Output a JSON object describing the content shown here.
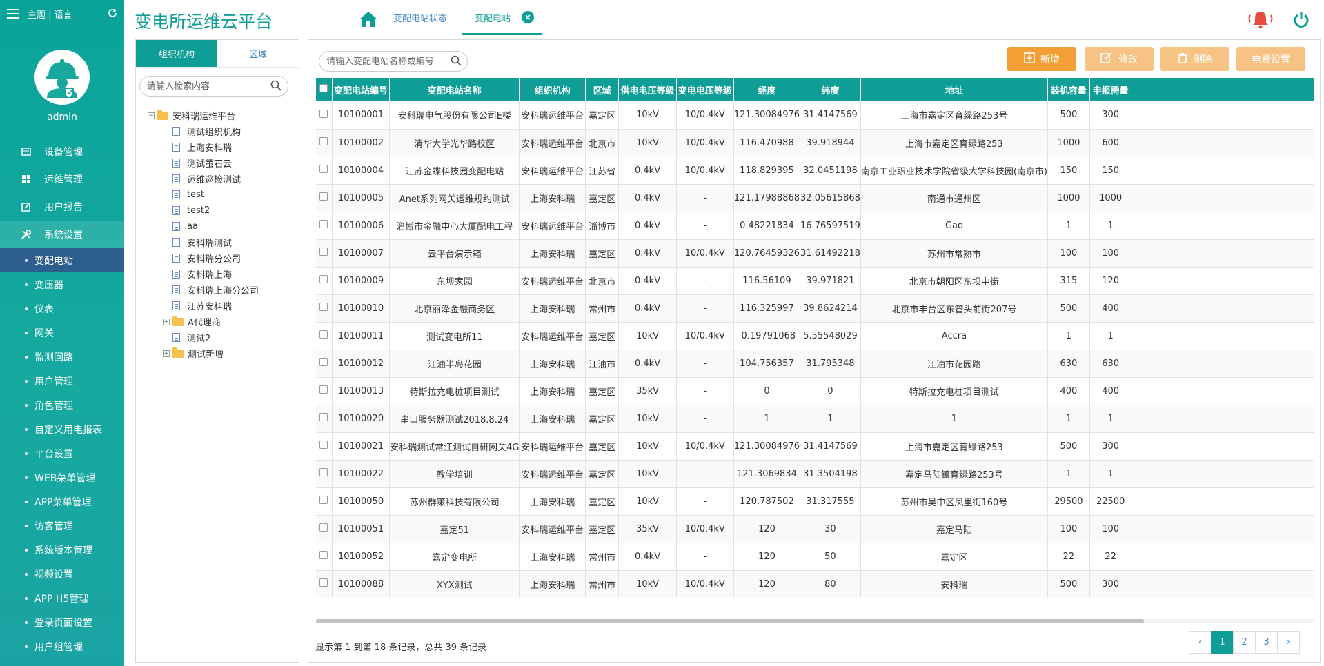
{
  "app": {
    "title": "变电所运维云平台",
    "theme_lang": "主题 | 语言",
    "username": "admin"
  },
  "colors": {
    "primary": "#0e9e97",
    "sidebar": "#0aa39a",
    "active_sub": "#2c5f8d",
    "btn_add": "#f2a035",
    "btn_disabled": "#f7c384",
    "bell": "#e74c3c"
  },
  "sidebar": {
    "groups": [
      {
        "label": "设备管理",
        "icon": "device-icon"
      },
      {
        "label": "运维管理",
        "icon": "grid-icon"
      },
      {
        "label": "用户报告",
        "icon": "edit-icon"
      },
      {
        "label": "系统设置",
        "icon": "tools-icon"
      }
    ],
    "sub_items": [
      "变配电站",
      "变压器",
      "仪表",
      "网关",
      "监测回路",
      "用户管理",
      "角色管理",
      "自定义用电报表",
      "平台设置",
      "WEB菜单管理",
      "APP菜单管理",
      "访客管理",
      "系统版本管理",
      "视频设置",
      "APP H5管理",
      "登录页面设置",
      "用户组管理"
    ]
  },
  "header": {
    "tabs": [
      "变配电站状态",
      "变配电站"
    ]
  },
  "tree_panel": {
    "tabs": [
      "组织机构",
      "区域"
    ],
    "search_placeholder": "请输入检索内容",
    "root": "安科瑞运维平台",
    "nodes": [
      {
        "label": "测试组织机构",
        "type": "doc"
      },
      {
        "label": "上海安科瑞",
        "type": "doc"
      },
      {
        "label": "测试萤石云",
        "type": "doc"
      },
      {
        "label": "运维巡检测试",
        "type": "doc"
      },
      {
        "label": "test",
        "type": "doc"
      },
      {
        "label": "test2",
        "type": "doc"
      },
      {
        "label": "aa",
        "type": "doc"
      },
      {
        "label": "安科瑞测试",
        "type": "doc"
      },
      {
        "label": "安科瑞分公司",
        "type": "doc"
      },
      {
        "label": "安科瑞上海",
        "type": "doc"
      },
      {
        "label": "安科瑞上海分公司",
        "type": "doc"
      },
      {
        "label": "江苏安科瑞",
        "type": "doc"
      },
      {
        "label": "A代理商",
        "type": "folder"
      },
      {
        "label": "测试2",
        "type": "doc"
      },
      {
        "label": "测试新增",
        "type": "folder"
      }
    ]
  },
  "main": {
    "search_placeholder": "请输入变配电站名称或编号",
    "buttons": {
      "add": "新增",
      "edit": "修改",
      "delete": "删除",
      "fee": "电费设置"
    },
    "columns": [
      "变配电站编号",
      "变配电站名称",
      "组织机构",
      "区域",
      "供电电压等级",
      "变电电压等级",
      "经度",
      "纬度",
      "地址",
      "装机容量",
      "申报需量"
    ],
    "rows": [
      [
        "10100001",
        "安科瑞电气股份有限公司E楼",
        "安科瑞运维平台",
        "嘉定区",
        "10kV",
        "10/0.4kV",
        "121.30084976",
        "31.4147569",
        "上海市嘉定区育绿路253号",
        "500",
        "300"
      ],
      [
        "10100002",
        "清华大学光华路校区",
        "安科瑞运维平台",
        "北京市",
        "10kV",
        "10/0.4kV",
        "116.470988",
        "39.918944",
        "上海市嘉定区育绿路253",
        "1000",
        "600"
      ],
      [
        "10100004",
        "江苏金蝶科技园变配电站",
        "安科瑞运维平台",
        "江苏省",
        "0.4kV",
        "10/0.4kV",
        "118.829395",
        "32.0451198",
        "南京工业职业技术学院省级大学科技园(南京市)",
        "150",
        "150"
      ],
      [
        "10100005",
        "Anet系列网关运维规约测试",
        "上海安科瑞",
        "嘉定区",
        "0.4kV",
        "-",
        "121.17988868",
        "32.05615868",
        "南通市通州区",
        "1000",
        "1000"
      ],
      [
        "10100006",
        "淄博市金融中心大厦配电工程",
        "安科瑞运维平台",
        "淄博市",
        "0.4kV",
        "-",
        "0.48221834",
        "16.76597519",
        "Gao",
        "1",
        "1"
      ],
      [
        "10100007",
        "云平台演示箱",
        "上海安科瑞",
        "嘉定区",
        "0.4kV",
        "10/0.4kV",
        "120.76459326",
        "31.61492218",
        "苏州市常熟市",
        "100",
        "100"
      ],
      [
        "10100009",
        "东坝家园",
        "安科瑞运维平台",
        "北京市",
        "0.4kV",
        "-",
        "116.56109",
        "39.971821",
        "北京市朝阳区东坝中街",
        "315",
        "120"
      ],
      [
        "10100010",
        "北京丽泽金融商务区",
        "上海安科瑞",
        "常州市",
        "0.4kV",
        "-",
        "116.325997",
        "39.8624214",
        "北京市丰台区东管头前街207号",
        "500",
        "400"
      ],
      [
        "10100011",
        "测试变电所11",
        "安科瑞运维平台",
        "嘉定区",
        "10kV",
        "10/0.4kV",
        "-0.19791068",
        "5.55548029",
        "Accra",
        "1",
        "1"
      ],
      [
        "10100012",
        "江油半岛花园",
        "上海安科瑞",
        "江油市",
        "0.4kV",
        "-",
        "104.756357",
        "31.795348",
        "江油市花园路",
        "630",
        "630"
      ],
      [
        "10100013",
        "特斯拉充电桩项目测试",
        "上海安科瑞",
        "嘉定区",
        "35kV",
        "-",
        "0",
        "0",
        "特斯拉充电桩项目测试",
        "400",
        "400"
      ],
      [
        "10100020",
        "串口服务器测试2018.8.24",
        "上海安科瑞",
        "嘉定区",
        "10kV",
        "-",
        "1",
        "1",
        "1",
        "1",
        "1"
      ],
      [
        "10100021",
        "安科瑞测试常江测试自研网关4G",
        "安科瑞运维平台",
        "嘉定区",
        "10kV",
        "10/0.4kV",
        "121.30084976",
        "31.4147569",
        "上海市嘉定区育绿路253",
        "500",
        "300"
      ],
      [
        "10100022",
        "教学培训",
        "安科瑞运维平台",
        "嘉定区",
        "10kV",
        "-",
        "121.3069834",
        "31.3504198",
        "嘉定马陆镇育绿路253号",
        "1",
        "1"
      ],
      [
        "10100050",
        "苏州群策科技有限公司",
        "上海安科瑞",
        "嘉定区",
        "10kV",
        "-",
        "120.787502",
        "31.317555",
        "苏州市吴中区凤里街160号",
        "29500",
        "22500"
      ],
      [
        "10100051",
        "嘉定51",
        "安科瑞运维平台",
        "嘉定区",
        "35kV",
        "10/0.4kV",
        "120",
        "30",
        "嘉定马陆",
        "100",
        "100"
      ],
      [
        "10100052",
        "嘉定变电所",
        "上海安科瑞",
        "常州市",
        "0.4kV",
        "-",
        "120",
        "50",
        "嘉定区",
        "22",
        "22"
      ],
      [
        "10100088",
        "XYX测试",
        "上海安科瑞",
        "常州市",
        "10kV",
        "10/0.4kV",
        "120",
        "80",
        "安科瑞",
        "500",
        "300"
      ]
    ],
    "footer_info": "显示第 1 到第 18 条记录，总共 39 条记录",
    "pager": [
      "‹",
      "1",
      "2",
      "3",
      "›"
    ],
    "current_page": "1"
  }
}
